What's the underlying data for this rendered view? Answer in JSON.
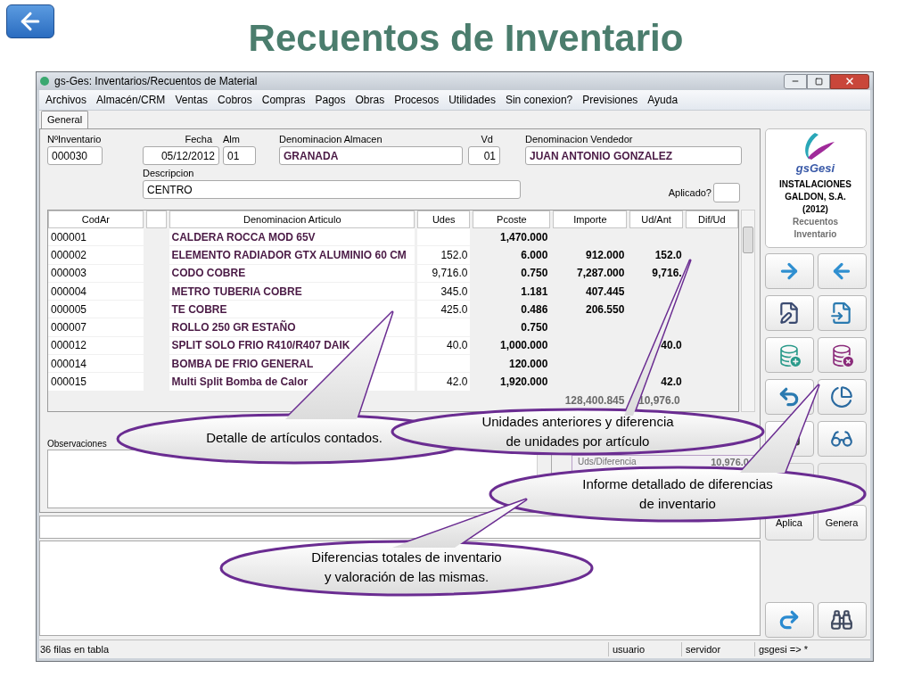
{
  "slide": {
    "title": "Recuentos de Inventario"
  },
  "window": {
    "title": "gs-Ges: Inventarios/Recuentos de Material"
  },
  "menu": [
    "Archivos",
    "Almacén/CRM",
    "Ventas",
    "Cobros",
    "Compras",
    "Pagos",
    "Obras",
    "Procesos",
    "Utilidades",
    "Sin conexion?",
    "Previsiones",
    "Ayuda"
  ],
  "tabs": [
    {
      "label": "General",
      "selected": true
    }
  ],
  "form": {
    "inventario": {
      "label": "NºInventario",
      "value": "000030"
    },
    "fecha": {
      "label": "Fecha",
      "value": "05/12/2012"
    },
    "alm": {
      "label": "Alm",
      "value": "01"
    },
    "almacen": {
      "label": "Denominacion Almacen",
      "value": "GRANADA"
    },
    "vd": {
      "label": "Vd",
      "value": "01"
    },
    "vendedor": {
      "label": "Denominacion Vendedor",
      "value": "JUAN ANTONIO GONZALEZ"
    },
    "descripcion": {
      "label": "Descripcion",
      "value": "CENTRO"
    },
    "aplicado": {
      "label": "Aplicado?",
      "checked": false
    }
  },
  "table": {
    "columns": [
      {
        "kind": "text",
        "label": "CodAr"
      },
      {
        "kind": "spacer"
      },
      {
        "kind": "text",
        "label": "Denominacion Articulo"
      },
      {
        "kind": "text",
        "label": "Udes"
      },
      {
        "kind": "text",
        "label": "Pcoste"
      },
      {
        "kind": "text",
        "label": "Importe"
      },
      {
        "kind": "text",
        "label": "Ud/Ant"
      },
      {
        "kind": "text",
        "label": "Dif/Ud"
      }
    ],
    "rows": [
      {
        "cells": [
          "000001",
          "",
          "CALDERA ROCCA MOD 65V",
          "",
          "1,470.000",
          "",
          "",
          ""
        ]
      },
      {
        "cells": [
          "000002",
          "",
          "ELEMENTO RADIADOR  GTX ALUMINIO 60 CM",
          "152.0",
          "6.000",
          "912.000",
          "152.0",
          ""
        ]
      },
      {
        "cells": [
          "000003",
          "",
          "CODO COBRE",
          "9,716.0",
          "0.750",
          "7,287.000",
          "9,716.",
          ""
        ]
      },
      {
        "cells": [
          "000004",
          "",
          "METRO TUBERIA COBRE",
          "345.0",
          "1.181",
          "407.445",
          "",
          ""
        ]
      },
      {
        "cells": [
          "000005",
          "",
          "TE COBRE",
          "425.0",
          "0.486",
          "206.550",
          "",
          ""
        ]
      },
      {
        "cells": [
          "000007",
          "",
          "ROLLO 250 GR ESTAÑO",
          "",
          "0.750",
          "",
          "",
          ""
        ]
      },
      {
        "cells": [
          "000012",
          "",
          "SPLIT SOLO FRIO R410/R407 DAIK",
          "40.0",
          "1,000.000",
          "",
          "40.0",
          ""
        ]
      },
      {
        "cells": [
          "000014",
          "",
          "BOMBA DE FRIO GENERAL",
          "",
          "120.000",
          "",
          "",
          ""
        ]
      },
      {
        "cells": [
          "000015",
          "",
          "Multi Split Bomba de Calor",
          "42.0",
          "1,920.000",
          "",
          "42.0",
          ""
        ]
      }
    ],
    "totals": {
      "importe": "128,400.845",
      "ud_ant": "10,976.0"
    }
  },
  "observaciones": {
    "label": "Observaciones"
  },
  "summary": {
    "label": "Uds/Diferencia",
    "value": "10,976.0"
  },
  "company": {
    "logo_text": "gsGesi",
    "name": "INSTALACIONES GALDON, S.A.",
    "year": "(2012)",
    "module": "Recuentos Inventario"
  },
  "action_buttons": [
    "Aplica",
    "Genera"
  ],
  "status_bar": [
    "36 filas en tabla",
    "usuario",
    "servidor",
    "gsgesi => *"
  ],
  "callouts": [
    {
      "lines": [
        "Detalle de artículos contados."
      ]
    },
    {
      "lines": [
        "Unidades anteriores y diferencia",
        "de unidades por artículo"
      ]
    },
    {
      "lines": [
        "Informe detallado de diferencias",
        "de inventario"
      ]
    },
    {
      "lines": [
        "Diferencias totales de inventario",
        "y valoración de las mismas."
      ]
    }
  ]
}
